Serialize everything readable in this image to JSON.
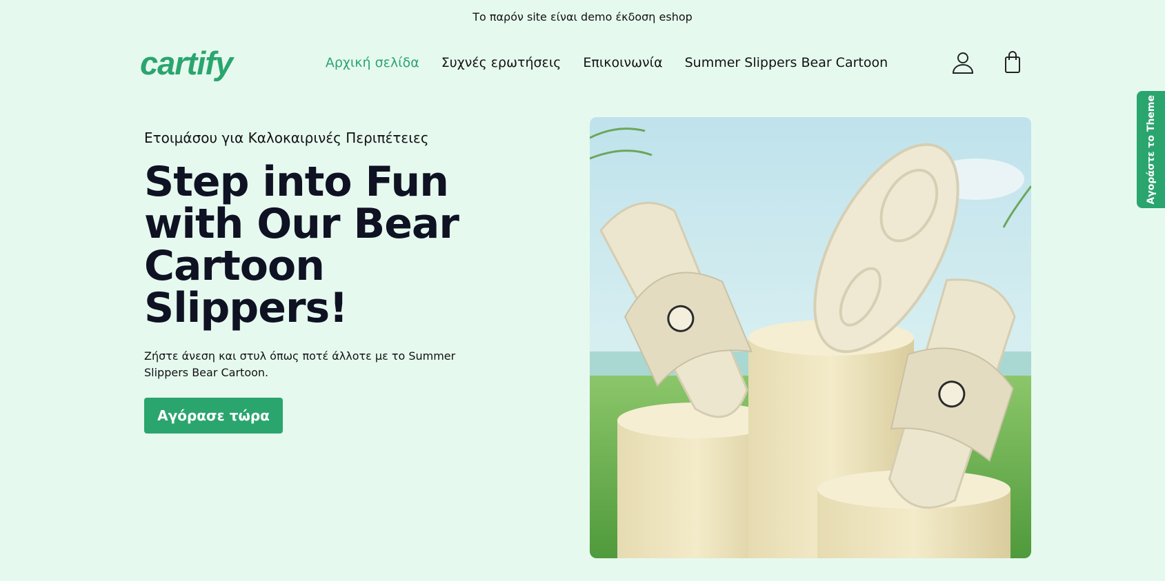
{
  "announcement": "Το παρόν site είναι demo έκδοση eshop",
  "header": {
    "logo": "cartify",
    "nav": [
      {
        "label": "Αρχική σελίδα",
        "active": true
      },
      {
        "label": "Συχνές ερωτήσεις",
        "active": false
      },
      {
        "label": "Επικοινωνία",
        "active": false
      },
      {
        "label": "Summer Slippers Bear Cartoon",
        "active": false
      }
    ],
    "icons": [
      "account-icon",
      "cart-icon"
    ]
  },
  "hero": {
    "eyebrow": "Ετοιμάσου για Καλοκαιρινές Περιπέτειες",
    "headline": "Step into Fun with Our Bear Cartoon Slippers!",
    "description": "Ζήστε άνεση και στυλ όπως ποτέ άλλοτε με το Summer Slippers Bear Cartoon.",
    "cta_label": "Αγόρασε τώρα"
  },
  "side_tab": "Αγοράστε το Theme",
  "colors": {
    "accent": "#2aa56e",
    "background": "#e6f9ef",
    "text": "#0f1222"
  }
}
